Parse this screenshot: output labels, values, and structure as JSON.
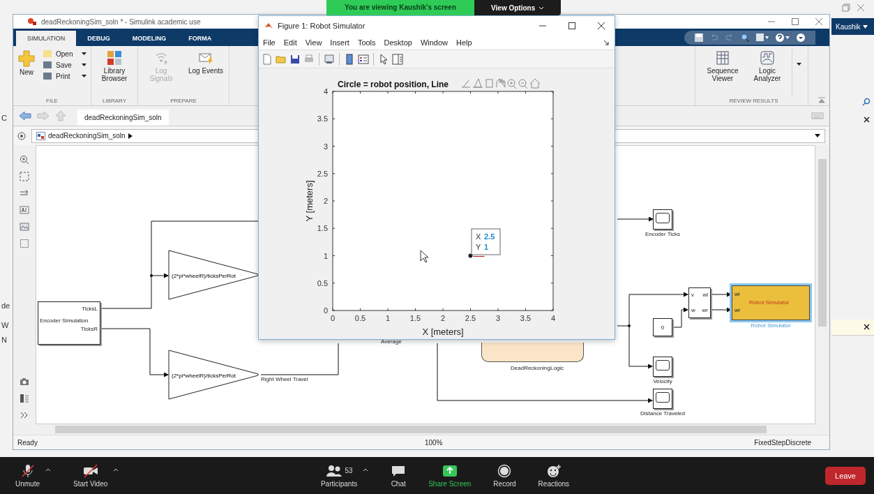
{
  "screen_share_banner": {
    "message": "You are viewing Kaushik's screen",
    "options_label": "View Options"
  },
  "matlab": {
    "user": "Kaushik",
    "left_edge_labels": [
      "C",
      "de",
      "W",
      "N"
    ]
  },
  "simulink": {
    "title": "deadReckoningSim_soln * - Simulink academic use",
    "tabs": [
      {
        "label": "SIMULATION",
        "selected": true
      },
      {
        "label": "DEBUG",
        "selected": false
      },
      {
        "label": "MODELING",
        "selected": false
      },
      {
        "label": "FORMA",
        "selected": false
      }
    ],
    "file_group": {
      "label": "FILE",
      "new_label": "New",
      "menu_items": [
        "Open",
        "Save",
        "Print"
      ]
    },
    "groups": [
      {
        "label": "LIBRARY",
        "commands": [
          {
            "label": "Library Browser",
            "disabled": false
          }
        ]
      },
      {
        "label": "PREPARE",
        "commands": [
          {
            "label": "Log Signals",
            "disabled": true
          },
          {
            "label": "Log Events",
            "disabled": false
          }
        ]
      }
    ],
    "right_groups": [
      {
        "label": "REVIEW RESULTS",
        "commands": [
          {
            "label": "Sequence Viewer",
            "disabled": false
          },
          {
            "label": "Logic Analyzer",
            "disabled": false
          }
        ]
      }
    ],
    "model_tab": "deadReckoningSim_soln",
    "breadcrumb": "deadReckoningSim_soln",
    "diagram": {
      "encoder": {
        "name": "Encoder Simulation",
        "ports": [
          "TicksL",
          "TicksR"
        ]
      },
      "gains": [
        "(2*pi*wheelR)/ticksPerRot",
        "(2*pi*wheelR)/ticksPerRot"
      ],
      "signal_labels": [
        "Right Wheel Travel",
        "Average"
      ],
      "logic_block": "DeadReckoningLogic",
      "scopes": [
        "Encoder Ticks",
        "Velocity",
        "Distance Traveled"
      ],
      "constant": "0",
      "mux": {
        "inputs": [
          "v",
          "w"
        ],
        "outputs": [
          "wl",
          "wr"
        ]
      },
      "robot_block": {
        "text": "Robot Simulator",
        "caption": "Robot Simulator",
        "ports": [
          "wl",
          "wr"
        ],
        "selected": true
      }
    },
    "status_bar": {
      "state": "Ready",
      "zoom": "100%",
      "solver": "FixedStepDiscrete"
    }
  },
  "figure": {
    "title": "Figure 1: Robot Simulator",
    "menu": [
      "File",
      "Edit",
      "View",
      "Insert",
      "Tools",
      "Desktop",
      "Window",
      "Help"
    ],
    "chart_data": {
      "type": "scatter",
      "title": "Circle = robot position, Line",
      "xlabel": "X [meters]",
      "ylabel": "Y [meters]",
      "x": [
        2.5
      ],
      "series": [
        {
          "color": "#1a1a2e",
          "values": [
            1
          ]
        }
      ],
      "xlim": [
        0,
        4
      ],
      "ylim": [
        0,
        4
      ],
      "xticks": [
        0,
        0.5,
        1,
        1.5,
        2,
        2.5,
        3,
        3.5,
        4
      ],
      "yticks": [
        0,
        0.5,
        1,
        1.5,
        2,
        2.5,
        3,
        3.5,
        4
      ]
    },
    "datatip": {
      "x_label": "X",
      "x_value": "2.5",
      "y_label": "Y",
      "y_value": "1"
    }
  },
  "meeting_toolbar": {
    "left_controls": [
      {
        "kind": "mic",
        "label": "Unmute",
        "off": true,
        "menu": true
      },
      {
        "kind": "video",
        "label": "Start Video",
        "off": true,
        "menu": true
      }
    ],
    "center_controls": [
      {
        "kind": "participants",
        "label": "Participants",
        "count": "53",
        "menu": true
      },
      {
        "kind": "chat",
        "label": "Chat",
        "menu": false
      },
      {
        "kind": "share",
        "label": "Share Screen",
        "menu": false
      },
      {
        "kind": "record",
        "label": "Record",
        "menu": false
      },
      {
        "kind": "reactions",
        "label": "Reactions",
        "menu": false
      }
    ],
    "leave_label": "Leave"
  }
}
